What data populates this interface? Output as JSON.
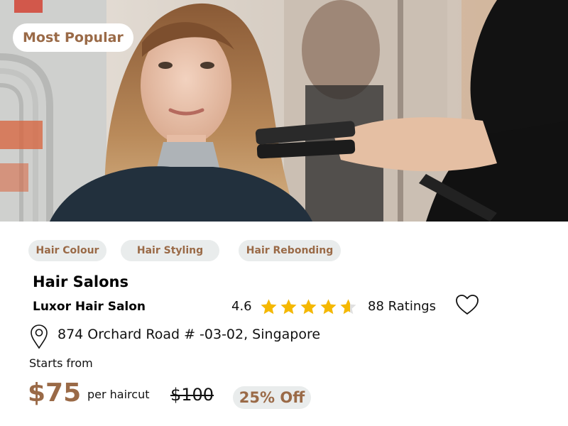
{
  "badge": {
    "label": "Most Popular"
  },
  "tags": [
    {
      "label": "Hair Colour"
    },
    {
      "label": "Hair Styling"
    },
    {
      "label": "Hair Rebonding"
    }
  ],
  "listing": {
    "category": "Hair Salons",
    "name": "Luxor Hair Salon",
    "rating": "4.6",
    "rating_value": 4.6,
    "rating_max": 5,
    "ratings_count": "88 Ratings",
    "address": "874 Orchard Road # -03-02, Singapore"
  },
  "pricing": {
    "starts_label": "Starts from",
    "price": "$75",
    "unit": "per haircut",
    "original_price": "$100",
    "discount": "25% Off"
  },
  "icons": {
    "star": "star-icon",
    "heart": "heart-icon",
    "location": "location-pin-icon"
  },
  "colors": {
    "accent": "#9a6a47",
    "chip_bg": "#e9ecec",
    "star": "#f5b800",
    "star_empty": "#e0e0e0"
  }
}
